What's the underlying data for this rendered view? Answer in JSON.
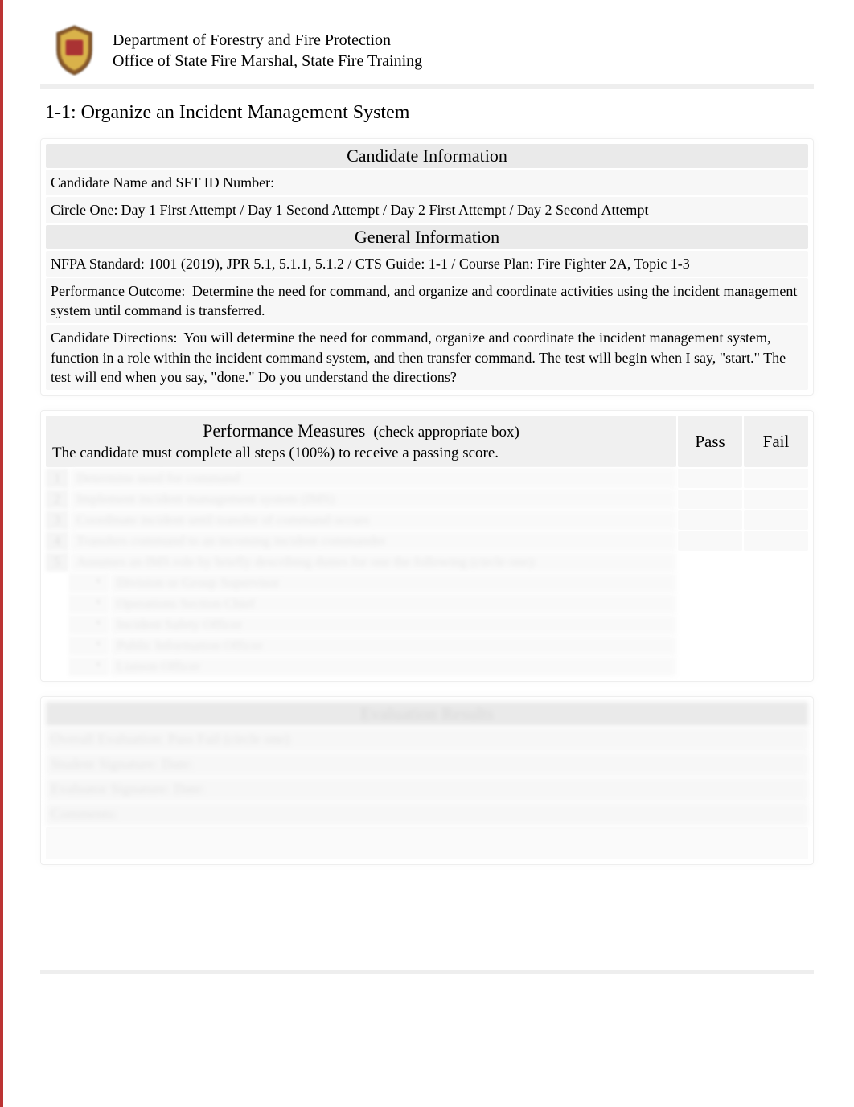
{
  "header": {
    "dept_line1": "Department of Forestry and Fire Protection",
    "dept_line2": "Office of State Fire Marshal, State Fire Training"
  },
  "title": "1-1: Organize an Incident Management System",
  "candidate_info": {
    "heading": "Candidate Information",
    "name_label": "Candidate Name and SFT ID Number:",
    "circle_label": "Circle One:",
    "circle_options": "Day 1 First Attempt / Day 1 Second Attempt / Day 2 First Attempt / Day 2 Second Attempt"
  },
  "general_info": {
    "heading": "General Information",
    "nfpa_label": "NFPA Standard:",
    "nfpa_value": "1001 (2019), JPR 5.1, 5.1.1, 5.1.2 /",
    "cts_label": "CTS Guide:",
    "cts_value": "1-1 /",
    "course_label": "Course Plan:",
    "course_value": "Fire Fighter 2A, Topic 1-3",
    "perf_outcome_label": "Performance Outcome:",
    "perf_outcome_value": "Determine the need for command, and organize and coordinate activities using the incident management system until command is transferred.",
    "directions_label": "Candidate Directions:",
    "directions_lead": "You will",
    "directions_action": "determine the need for command, organize and coordinate the incident management system, function in a role within the incident command system, and then transfer command",
    "directions_tail": ". The test will begin when I say, \"start.\" The test will end when you say, \"done.\" Do you understand the directions?"
  },
  "performance": {
    "heading": "Performance Measures",
    "sub": "(check appropriate box)",
    "note": "The candidate must complete all steps (100%) to receive a passing score.",
    "col_pass": "Pass",
    "col_fail": "Fail",
    "rows": [
      {
        "n": "1",
        "text": "Determine need for command"
      },
      {
        "n": "2",
        "text": "Implement incident management system (IMS)"
      },
      {
        "n": "3",
        "text": "Coordinate incident until transfer of command occurs"
      },
      {
        "n": "4",
        "text": "Transfers command to an incoming incident commander"
      },
      {
        "n": "5",
        "text": "Assumes an IMS role by briefly describing duties for one the following (circle one):"
      }
    ],
    "subitems": [
      "Division or Group Supervisor",
      "Operations Section Chief",
      "Incident Safety Officer",
      "Public Information Officer",
      "Liaison Officer"
    ]
  },
  "evaluation": {
    "heading": "Evaluation Results",
    "overall": "Overall Evaluation:     Pass           Fail     (circle one)",
    "student": "Student Signature:    Date:",
    "evaluator": "Evaluator Signature:   Date:",
    "comments_label": "Comments:"
  }
}
